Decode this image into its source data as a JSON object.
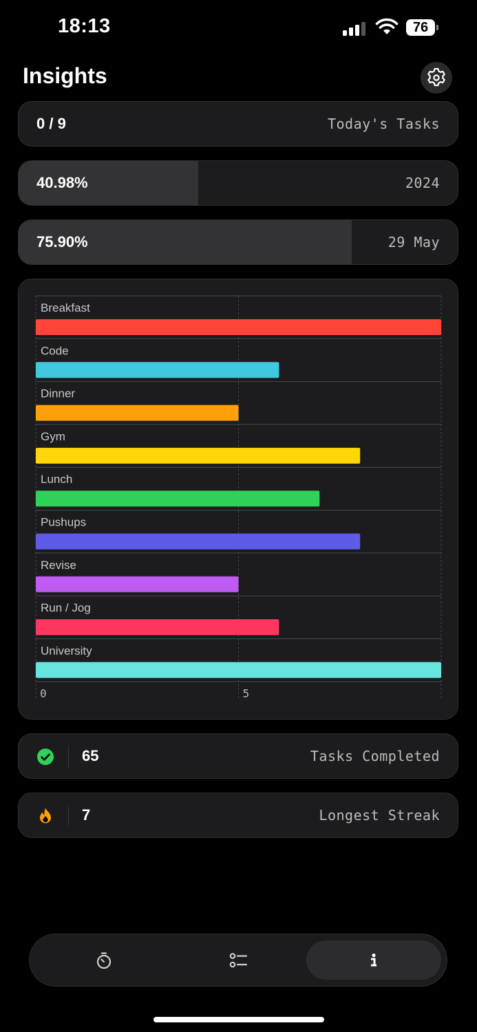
{
  "status_bar": {
    "time": "18:13",
    "battery": "76"
  },
  "header": {
    "title": "Insights"
  },
  "cards": {
    "today": {
      "value": "0 / 9",
      "label": "Today's Tasks"
    },
    "year": {
      "value": "40.98%",
      "label": "2024",
      "progress": 0.4098
    },
    "day": {
      "value": "75.90%",
      "label": "29 May",
      "progress": 0.759
    }
  },
  "chart_data": {
    "type": "bar",
    "orientation": "horizontal",
    "categories": [
      "Breakfast",
      "Code",
      "Dinner",
      "Gym",
      "Lunch",
      "Pushups",
      "Revise",
      "Run / Jog",
      "University"
    ],
    "values": [
      10,
      6,
      5,
      8,
      7,
      8,
      5,
      6,
      10
    ],
    "colors": [
      "#ff453a",
      "#40c8e0",
      "#ff9f0a",
      "#ffd60a",
      "#30d158",
      "#5e5ce6",
      "#bf5af2",
      "#ff375f",
      "#66e4dd"
    ],
    "xlim": [
      0,
      10
    ],
    "x_ticks": [
      "0",
      "5"
    ],
    "grid": true
  },
  "stats": {
    "completed": {
      "value": "65",
      "label": "Tasks Completed",
      "icon": "checkmark-circle-icon",
      "color": "#30d158"
    },
    "streak": {
      "value": "7",
      "label": "Longest Streak",
      "icon": "flame-icon",
      "color": "#ff9f0a"
    }
  },
  "tabbar": {
    "tabs": [
      {
        "icon": "timer-icon",
        "active": false
      },
      {
        "icon": "list-icon",
        "active": false
      },
      {
        "icon": "info-icon",
        "active": true
      }
    ]
  }
}
